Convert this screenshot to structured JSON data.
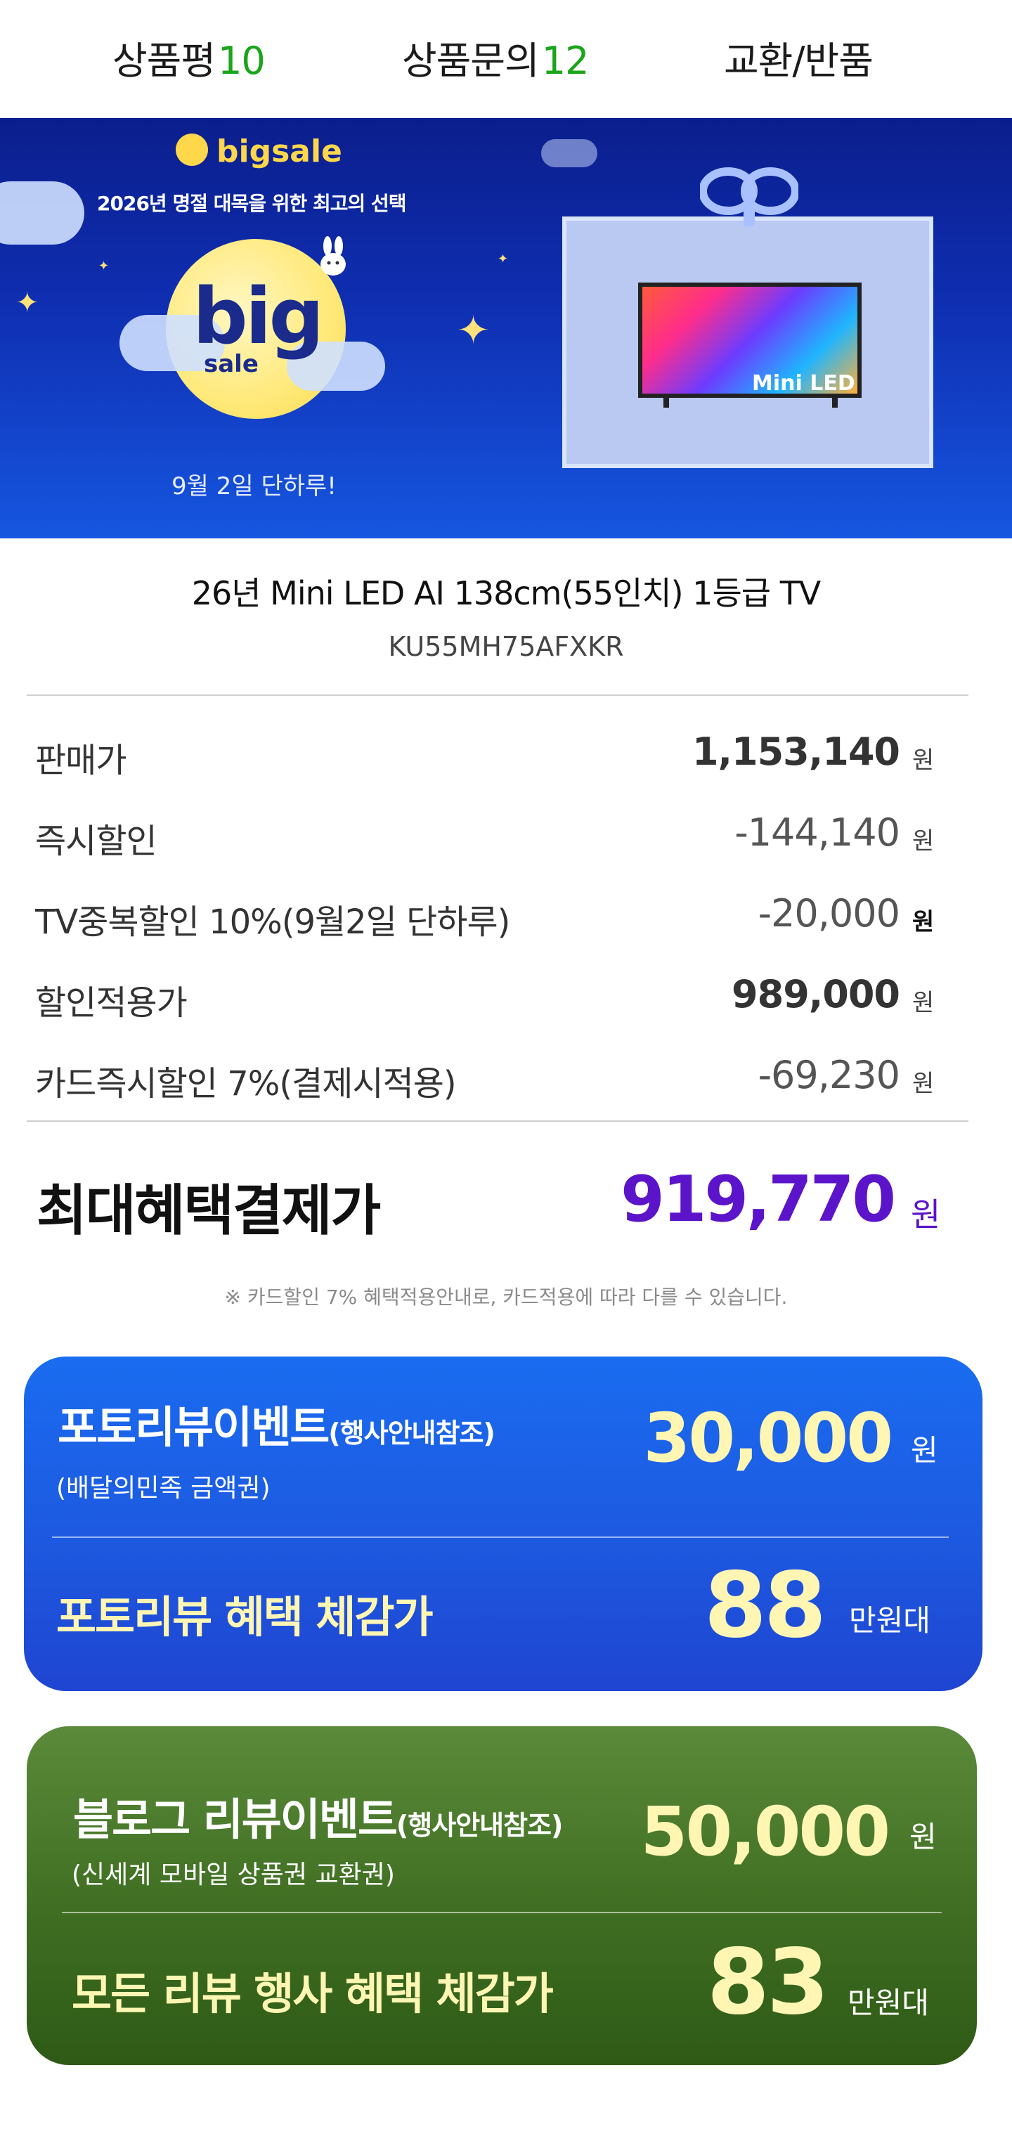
{
  "tabs": [
    {
      "label": "상품평",
      "count": "10"
    },
    {
      "label": "상품문의",
      "count": "12"
    },
    {
      "label": "교환/반품",
      "count": ""
    }
  ],
  "banner": {
    "brand": "bigsale",
    "subtitle": "2026년 명절 대목을 위한 최고의 선택",
    "badge_big": "big",
    "badge_sale": "sale",
    "date": "9월 2일 단하루!",
    "tv_label": "Mini LED"
  },
  "product": {
    "title": "26년 Mini LED AI  138cm(55인치) 1등급 TV",
    "model": "KU55MH75AFXKR"
  },
  "prices": [
    {
      "label": "판매가",
      "value": "1,153,140",
      "unit": "원"
    },
    {
      "label": "즉시할인",
      "value": "-144,140",
      "unit": "원"
    },
    {
      "label": "TV중복할인 10%(9월2일 단하루)",
      "value": "-20,000",
      "unit": "원"
    },
    {
      "label": "할인적용가",
      "value": "989,000",
      "unit": "원"
    },
    {
      "label": "카드즉시할인 7%(결제시적용)",
      "value": "-69,230",
      "unit": "원"
    }
  ],
  "best": {
    "label": "최대혜택결제가",
    "value": "919,770",
    "unit": "원",
    "note": "※ 카드할인 7% 혜택적용안내로, 카드적용에 따라 다를 수 있습니다."
  },
  "event1": {
    "title": "포토리뷰이벤트",
    "title_note": "(행사안내참조)",
    "sub": "(배달의민족 금액권)",
    "amount": "30,000",
    "amount_unit": "원",
    "bottom_label": "포토리뷰 혜택  체감가",
    "bottom_value": "88",
    "bottom_unit": "만원대"
  },
  "event2": {
    "title": "블로그 리뷰이벤트",
    "title_note": "(행사안내참조)",
    "sub": "(신세계 모바일 상품권 교환권)",
    "amount": "50,000",
    "amount_unit": "원",
    "bottom_label": "모든 리뷰 행사 혜택 체감가",
    "bottom_value": "83",
    "bottom_unit": "만원대"
  }
}
